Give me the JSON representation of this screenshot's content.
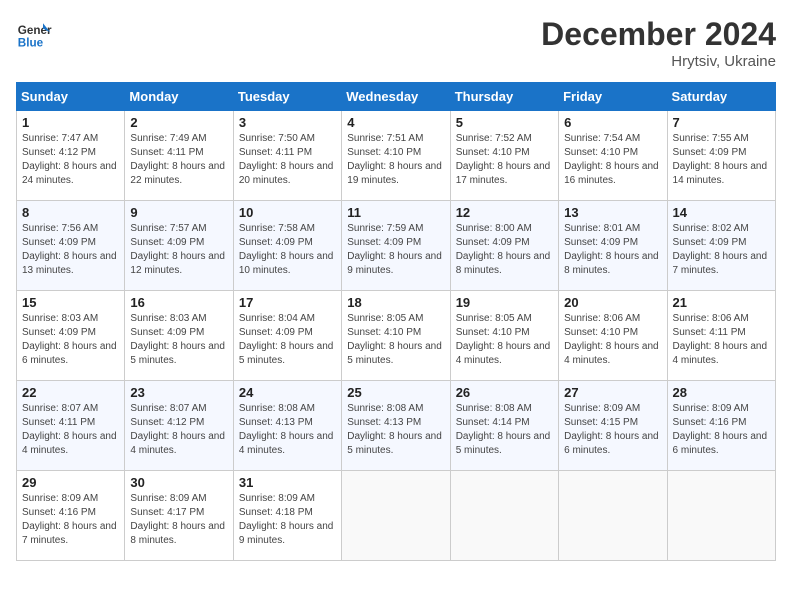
{
  "header": {
    "logo_line1": "General",
    "logo_line2": "Blue",
    "month": "December 2024",
    "location": "Hrytsiv, Ukraine"
  },
  "days_of_week": [
    "Sunday",
    "Monday",
    "Tuesday",
    "Wednesday",
    "Thursday",
    "Friday",
    "Saturday"
  ],
  "weeks": [
    [
      {
        "day": "1",
        "rise": "7:47 AM",
        "set": "4:12 PM",
        "daylight": "8 hours and 24 minutes."
      },
      {
        "day": "2",
        "rise": "7:49 AM",
        "set": "4:11 PM",
        "daylight": "8 hours and 22 minutes."
      },
      {
        "day": "3",
        "rise": "7:50 AM",
        "set": "4:11 PM",
        "daylight": "8 hours and 20 minutes."
      },
      {
        "day": "4",
        "rise": "7:51 AM",
        "set": "4:10 PM",
        "daylight": "8 hours and 19 minutes."
      },
      {
        "day": "5",
        "rise": "7:52 AM",
        "set": "4:10 PM",
        "daylight": "8 hours and 17 minutes."
      },
      {
        "day": "6",
        "rise": "7:54 AM",
        "set": "4:10 PM",
        "daylight": "8 hours and 16 minutes."
      },
      {
        "day": "7",
        "rise": "7:55 AM",
        "set": "4:09 PM",
        "daylight": "8 hours and 14 minutes."
      }
    ],
    [
      {
        "day": "8",
        "rise": "7:56 AM",
        "set": "4:09 PM",
        "daylight": "8 hours and 13 minutes."
      },
      {
        "day": "9",
        "rise": "7:57 AM",
        "set": "4:09 PM",
        "daylight": "8 hours and 12 minutes."
      },
      {
        "day": "10",
        "rise": "7:58 AM",
        "set": "4:09 PM",
        "daylight": "8 hours and 10 minutes."
      },
      {
        "day": "11",
        "rise": "7:59 AM",
        "set": "4:09 PM",
        "daylight": "8 hours and 9 minutes."
      },
      {
        "day": "12",
        "rise": "8:00 AM",
        "set": "4:09 PM",
        "daylight": "8 hours and 8 minutes."
      },
      {
        "day": "13",
        "rise": "8:01 AM",
        "set": "4:09 PM",
        "daylight": "8 hours and 8 minutes."
      },
      {
        "day": "14",
        "rise": "8:02 AM",
        "set": "4:09 PM",
        "daylight": "8 hours and 7 minutes."
      }
    ],
    [
      {
        "day": "15",
        "rise": "8:03 AM",
        "set": "4:09 PM",
        "daylight": "8 hours and 6 minutes."
      },
      {
        "day": "16",
        "rise": "8:03 AM",
        "set": "4:09 PM",
        "daylight": "8 hours and 5 minutes."
      },
      {
        "day": "17",
        "rise": "8:04 AM",
        "set": "4:09 PM",
        "daylight": "8 hours and 5 minutes."
      },
      {
        "day": "18",
        "rise": "8:05 AM",
        "set": "4:10 PM",
        "daylight": "8 hours and 5 minutes."
      },
      {
        "day": "19",
        "rise": "8:05 AM",
        "set": "4:10 PM",
        "daylight": "8 hours and 4 minutes."
      },
      {
        "day": "20",
        "rise": "8:06 AM",
        "set": "4:10 PM",
        "daylight": "8 hours and 4 minutes."
      },
      {
        "day": "21",
        "rise": "8:06 AM",
        "set": "4:11 PM",
        "daylight": "8 hours and 4 minutes."
      }
    ],
    [
      {
        "day": "22",
        "rise": "8:07 AM",
        "set": "4:11 PM",
        "daylight": "8 hours and 4 minutes."
      },
      {
        "day": "23",
        "rise": "8:07 AM",
        "set": "4:12 PM",
        "daylight": "8 hours and 4 minutes."
      },
      {
        "day": "24",
        "rise": "8:08 AM",
        "set": "4:13 PM",
        "daylight": "8 hours and 4 minutes."
      },
      {
        "day": "25",
        "rise": "8:08 AM",
        "set": "4:13 PM",
        "daylight": "8 hours and 5 minutes."
      },
      {
        "day": "26",
        "rise": "8:08 AM",
        "set": "4:14 PM",
        "daylight": "8 hours and 5 minutes."
      },
      {
        "day": "27",
        "rise": "8:09 AM",
        "set": "4:15 PM",
        "daylight": "8 hours and 6 minutes."
      },
      {
        "day": "28",
        "rise": "8:09 AM",
        "set": "4:16 PM",
        "daylight": "8 hours and 6 minutes."
      }
    ],
    [
      {
        "day": "29",
        "rise": "8:09 AM",
        "set": "4:16 PM",
        "daylight": "8 hours and 7 minutes."
      },
      {
        "day": "30",
        "rise": "8:09 AM",
        "set": "4:17 PM",
        "daylight": "8 hours and 8 minutes."
      },
      {
        "day": "31",
        "rise": "8:09 AM",
        "set": "4:18 PM",
        "daylight": "8 hours and 9 minutes."
      },
      null,
      null,
      null,
      null
    ]
  ]
}
